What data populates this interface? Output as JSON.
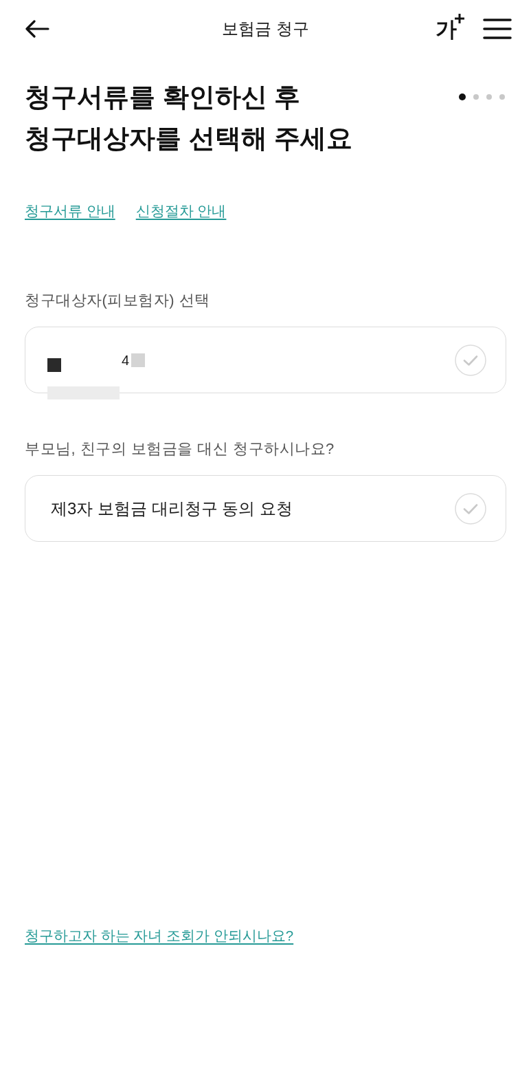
{
  "header": {
    "title": "보험금 청구",
    "font_size_button": {
      "label": "가"
    }
  },
  "heading": {
    "lines": [
      "청구서류를 확인하신 후",
      "청구대상자를 선택해 주세요"
    ]
  },
  "steps": [
    {
      "selected": true
    },
    {
      "selected": false
    },
    {
      "selected": false
    },
    {
      "selected": false
    }
  ],
  "links": [
    {
      "label": "청구서류 안내"
    },
    {
      "label": "신청절차 안내"
    }
  ],
  "sections": [
    {
      "label": "청구대상자(피보험자) 선택",
      "option": {
        "text": "4",
        "masked": true,
        "selected": false
      }
    },
    {
      "label": "부모님, 친구의 보험금을 대신 청구하시나요?",
      "option": {
        "text": "제3자 보험금 대리청구 동의 요청",
        "masked": false,
        "selected": false
      }
    }
  ],
  "footer_link": {
    "label": "청구하고자 하는 자녀 조회가 안되시나요?"
  }
}
